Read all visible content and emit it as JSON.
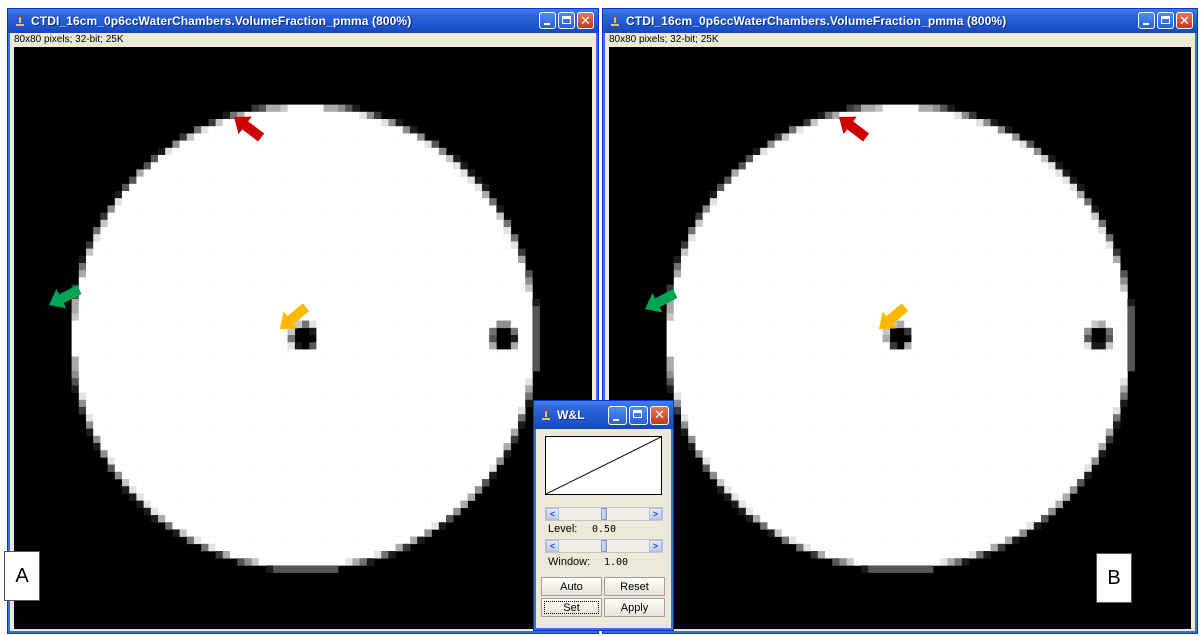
{
  "left_window": {
    "title": "CTDI_16cm_0p6ccWaterChambers.VolumeFraction_pmma (800%)",
    "info": "80x80 pixels; 32-bit; 25K",
    "panel_label": "A"
  },
  "right_window": {
    "title": "CTDI_16cm_0p6ccWaterChambers.VolumeFraction_pmma (800%)",
    "info": "80x80 pixels; 32-bit; 25K",
    "panel_label": "B"
  },
  "arrows": {
    "red": "#cc0000",
    "green": "#00a651",
    "yellow": "#ffb800"
  },
  "wl_dialog": {
    "title": "W&L",
    "level_label": "Level:",
    "level_value": "0.50",
    "window_label": "Window:",
    "window_value": "1.00",
    "level_slider_fraction": 0.5,
    "window_slider_fraction": 0.5,
    "buttons": {
      "auto": "Auto",
      "reset": "Reset",
      "set": "Set",
      "apply": "Apply"
    }
  },
  "colors": {
    "title_bar": "#2a62d8",
    "window_frame": "#0831d9",
    "phantom": "#ffffff",
    "background": "#000000"
  },
  "icons": {
    "title_icon": "imagej-microscope-icon",
    "minimize": "minimize-icon",
    "maximize": "maximize-icon",
    "close": "close-icon"
  }
}
